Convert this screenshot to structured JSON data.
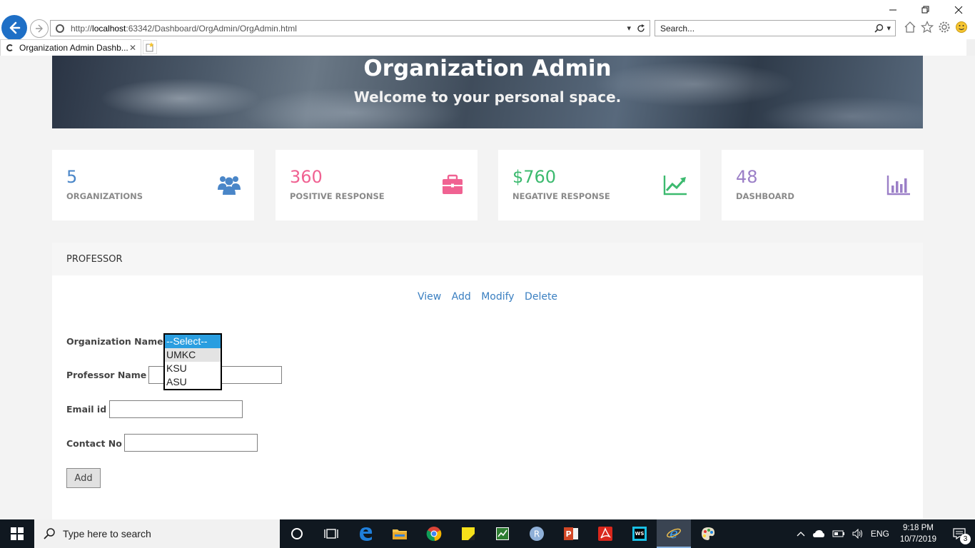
{
  "browser": {
    "url_prefix": "http://",
    "url_host": "localhost",
    "url_rest": ":63342/Dashboard/OrgAdmin/OrgAdmin.html",
    "search_placeholder": "Search...",
    "tab_title": "Organization Admin Dashb..."
  },
  "hero": {
    "title": "Organization Admin",
    "subtitle": "Welcome to your personal space."
  },
  "stats": [
    {
      "value": "5",
      "label": "ORGANIZATIONS",
      "color": "#4a86c8"
    },
    {
      "value": "360",
      "label": "POSITIVE RESPONSE",
      "color": "#f06292"
    },
    {
      "value": "$760",
      "label": "NEGATIVE RESPONSE",
      "color": "#3cba6f"
    },
    {
      "value": "48",
      "label": "DASHBOARD",
      "color": "#9b7fc7"
    }
  ],
  "panel": {
    "title": "PROFESSOR",
    "links": [
      "View",
      "Add",
      "Modify",
      "Delete"
    ]
  },
  "form": {
    "org_label": "Organization Name :",
    "prof_label": "Professor Name :",
    "email_label": "Email id :",
    "contact_label": "Contact No :",
    "add_label": "Add"
  },
  "dropdown": {
    "options": [
      "--Select--",
      "UMKC",
      "KSU",
      "ASU"
    ]
  },
  "taskbar": {
    "search_text": "Type here to search",
    "language": "ENG",
    "time": "9:18 PM",
    "date": "10/7/2019",
    "notification_count": "3"
  }
}
